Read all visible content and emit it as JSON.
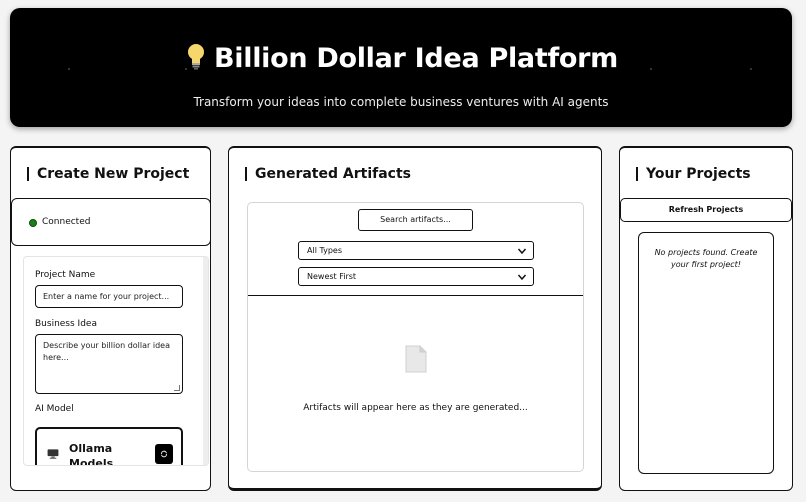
{
  "header": {
    "title": "Billion Dollar Idea Platform",
    "subtitle": "Transform your ideas into complete business ventures with AI agents",
    "icon": "lightbulb-icon"
  },
  "create_panel": {
    "title": "Create New Project",
    "status": {
      "label": "Connected",
      "color": "#1a7f1a"
    },
    "project_name": {
      "label": "Project Name",
      "placeholder": "Enter a name for your project..."
    },
    "business_idea": {
      "label": "Business Idea",
      "placeholder": "Describe your billion dollar idea here..."
    },
    "ai_model": {
      "label": "AI Model",
      "card_title": "Ollama Models (Local)",
      "card_icon": "monitor-icon",
      "refresh_icon": "refresh-icon"
    }
  },
  "artifacts_panel": {
    "title": "Generated Artifacts",
    "search_placeholder": "Search artifacts...",
    "type_filter": "All Types",
    "sort_order": "Newest First",
    "empty_icon": "file-icon",
    "empty_text": "Artifacts will appear here as they are generated..."
  },
  "projects_panel": {
    "title": "Your Projects",
    "refresh_label": "Refresh Projects",
    "empty_text": "No projects found. Create your first project!"
  }
}
